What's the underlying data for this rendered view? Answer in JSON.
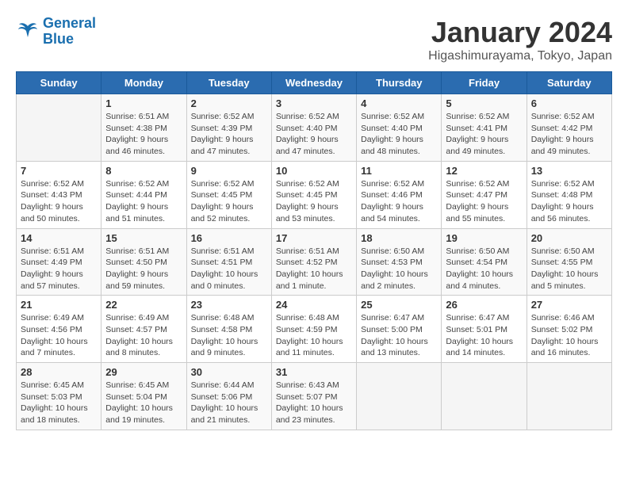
{
  "logo": {
    "line1": "General",
    "line2": "Blue"
  },
  "title": "January 2024",
  "subtitle": "Higashimurayama, Tokyo, Japan",
  "days_of_week": [
    "Sunday",
    "Monday",
    "Tuesday",
    "Wednesday",
    "Thursday",
    "Friday",
    "Saturday"
  ],
  "weeks": [
    [
      {
        "day": "",
        "info": ""
      },
      {
        "day": "1",
        "info": "Sunrise: 6:51 AM\nSunset: 4:38 PM\nDaylight: 9 hours\nand 46 minutes."
      },
      {
        "day": "2",
        "info": "Sunrise: 6:52 AM\nSunset: 4:39 PM\nDaylight: 9 hours\nand 47 minutes."
      },
      {
        "day": "3",
        "info": "Sunrise: 6:52 AM\nSunset: 4:40 PM\nDaylight: 9 hours\nand 47 minutes."
      },
      {
        "day": "4",
        "info": "Sunrise: 6:52 AM\nSunset: 4:40 PM\nDaylight: 9 hours\nand 48 minutes."
      },
      {
        "day": "5",
        "info": "Sunrise: 6:52 AM\nSunset: 4:41 PM\nDaylight: 9 hours\nand 49 minutes."
      },
      {
        "day": "6",
        "info": "Sunrise: 6:52 AM\nSunset: 4:42 PM\nDaylight: 9 hours\nand 49 minutes."
      }
    ],
    [
      {
        "day": "7",
        "info": "Sunrise: 6:52 AM\nSunset: 4:43 PM\nDaylight: 9 hours\nand 50 minutes."
      },
      {
        "day": "8",
        "info": "Sunrise: 6:52 AM\nSunset: 4:44 PM\nDaylight: 9 hours\nand 51 minutes."
      },
      {
        "day": "9",
        "info": "Sunrise: 6:52 AM\nSunset: 4:45 PM\nDaylight: 9 hours\nand 52 minutes."
      },
      {
        "day": "10",
        "info": "Sunrise: 6:52 AM\nSunset: 4:45 PM\nDaylight: 9 hours\nand 53 minutes."
      },
      {
        "day": "11",
        "info": "Sunrise: 6:52 AM\nSunset: 4:46 PM\nDaylight: 9 hours\nand 54 minutes."
      },
      {
        "day": "12",
        "info": "Sunrise: 6:52 AM\nSunset: 4:47 PM\nDaylight: 9 hours\nand 55 minutes."
      },
      {
        "day": "13",
        "info": "Sunrise: 6:52 AM\nSunset: 4:48 PM\nDaylight: 9 hours\nand 56 minutes."
      }
    ],
    [
      {
        "day": "14",
        "info": "Sunrise: 6:51 AM\nSunset: 4:49 PM\nDaylight: 9 hours\nand 57 minutes."
      },
      {
        "day": "15",
        "info": "Sunrise: 6:51 AM\nSunset: 4:50 PM\nDaylight: 9 hours\nand 59 minutes."
      },
      {
        "day": "16",
        "info": "Sunrise: 6:51 AM\nSunset: 4:51 PM\nDaylight: 10 hours\nand 0 minutes."
      },
      {
        "day": "17",
        "info": "Sunrise: 6:51 AM\nSunset: 4:52 PM\nDaylight: 10 hours\nand 1 minute."
      },
      {
        "day": "18",
        "info": "Sunrise: 6:50 AM\nSunset: 4:53 PM\nDaylight: 10 hours\nand 2 minutes."
      },
      {
        "day": "19",
        "info": "Sunrise: 6:50 AM\nSunset: 4:54 PM\nDaylight: 10 hours\nand 4 minutes."
      },
      {
        "day": "20",
        "info": "Sunrise: 6:50 AM\nSunset: 4:55 PM\nDaylight: 10 hours\nand 5 minutes."
      }
    ],
    [
      {
        "day": "21",
        "info": "Sunrise: 6:49 AM\nSunset: 4:56 PM\nDaylight: 10 hours\nand 7 minutes."
      },
      {
        "day": "22",
        "info": "Sunrise: 6:49 AM\nSunset: 4:57 PM\nDaylight: 10 hours\nand 8 minutes."
      },
      {
        "day": "23",
        "info": "Sunrise: 6:48 AM\nSunset: 4:58 PM\nDaylight: 10 hours\nand 9 minutes."
      },
      {
        "day": "24",
        "info": "Sunrise: 6:48 AM\nSunset: 4:59 PM\nDaylight: 10 hours\nand 11 minutes."
      },
      {
        "day": "25",
        "info": "Sunrise: 6:47 AM\nSunset: 5:00 PM\nDaylight: 10 hours\nand 13 minutes."
      },
      {
        "day": "26",
        "info": "Sunrise: 6:47 AM\nSunset: 5:01 PM\nDaylight: 10 hours\nand 14 minutes."
      },
      {
        "day": "27",
        "info": "Sunrise: 6:46 AM\nSunset: 5:02 PM\nDaylight: 10 hours\nand 16 minutes."
      }
    ],
    [
      {
        "day": "28",
        "info": "Sunrise: 6:45 AM\nSunset: 5:03 PM\nDaylight: 10 hours\nand 18 minutes."
      },
      {
        "day": "29",
        "info": "Sunrise: 6:45 AM\nSunset: 5:04 PM\nDaylight: 10 hours\nand 19 minutes."
      },
      {
        "day": "30",
        "info": "Sunrise: 6:44 AM\nSunset: 5:06 PM\nDaylight: 10 hours\nand 21 minutes."
      },
      {
        "day": "31",
        "info": "Sunrise: 6:43 AM\nSunset: 5:07 PM\nDaylight: 10 hours\nand 23 minutes."
      },
      {
        "day": "",
        "info": ""
      },
      {
        "day": "",
        "info": ""
      },
      {
        "day": "",
        "info": ""
      }
    ]
  ]
}
